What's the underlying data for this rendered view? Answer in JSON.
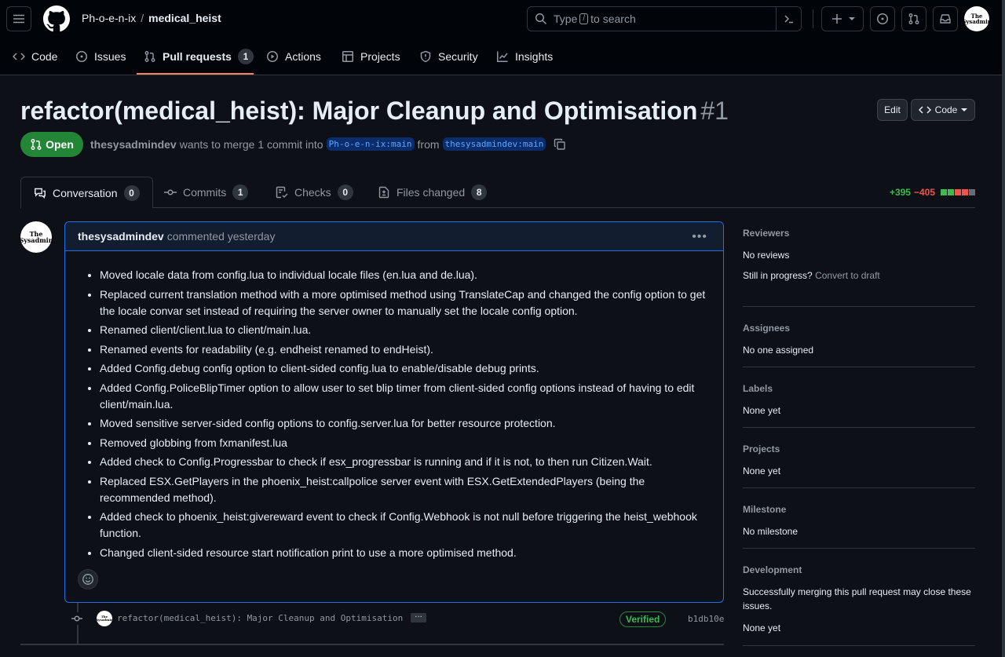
{
  "header": {
    "owner": "Ph-o-e-n-ix",
    "repo": "medical_heist",
    "search_prefix": "Type",
    "search_key": "/",
    "search_suffix": "to search",
    "avatar_text": "The Sysadmin"
  },
  "repo_tabs": [
    {
      "label": "Code",
      "icon": "code-icon"
    },
    {
      "label": "Issues",
      "icon": "issue-icon"
    },
    {
      "label": "Pull requests",
      "icon": "pull-request-icon",
      "count": "1"
    },
    {
      "label": "Actions",
      "icon": "play-icon"
    },
    {
      "label": "Projects",
      "icon": "table-icon"
    },
    {
      "label": "Security",
      "icon": "shield-icon"
    },
    {
      "label": "Insights",
      "icon": "graph-icon"
    }
  ],
  "pr": {
    "title": "refactor(medical_heist): Major Cleanup and Optimisation",
    "number": "#1",
    "edit_label": "Edit",
    "code_label": "Code",
    "state": "Open",
    "author": "thesysadmindev",
    "merge_text": "wants to merge 1 commit into",
    "base_branch": "Ph-o-e-n-ix:main",
    "from_text": "from",
    "head_branch": "thesysadmindev:main"
  },
  "pr_tabs": [
    {
      "label": "Conversation",
      "count": "0"
    },
    {
      "label": "Commits",
      "count": "1"
    },
    {
      "label": "Checks",
      "count": "0"
    },
    {
      "label": "Files changed",
      "count": "8"
    }
  ],
  "diffstat": {
    "additions": "+395",
    "deletions": "−405"
  },
  "comment": {
    "author": "thesysadmindev",
    "action": "commented yesterday",
    "items": [
      "Moved locale data from config.lua to individual locale files (en.lua and de.lua).",
      "Replaced current translation method with a more optimised method using TranslateCap and changed the config option to get the locale convar set instead of requiring the server owner to manually set the locale config option.",
      "Renamed client/client.lua to client/main.lua.",
      "Renamed events for readability (e.g. endheist renamed to endHeist).",
      "Added Config.debug config option to client-sided config.lua to enable/disable debug prints.",
      "Added Config.PoliceBlipTimer option to allow user to set blip timer from client-sided config options instead of having to edit client/main.lua.",
      "Moved sensitive server-sided config options to config.server.lua for better resource protection.",
      "Removed globbing from fxmanifest.lua",
      "Added check to Config.Progressbar to check if esx_progressbar is running and if it is not, to then run Citizen.Wait.",
      "Replaced ESX.GetPlayers in the phoenix_heist:callpolice server event with ESX.GetExtendedPlayers (being the recommended method).",
      "Added check to phoenix_heist:givereward event to check if Config.Webhook is not null before triggering the heist_webhook function.",
      "Changed client-sided resource start notification print to use a more optimised method."
    ]
  },
  "commit": {
    "message": "refactor(medical_heist): Major Cleanup and Optimisation",
    "ellipsis": "…",
    "verified": "Verified",
    "sha": "b1db10e"
  },
  "sidebar": {
    "reviewers": {
      "heading": "Reviewers",
      "value": "No reviews",
      "draft_question": "Still in progress?",
      "draft_link": "Convert to draft"
    },
    "assignees": {
      "heading": "Assignees",
      "value": "No one assigned"
    },
    "labels": {
      "heading": "Labels",
      "value": "None yet"
    },
    "projects": {
      "heading": "Projects",
      "value": "None yet"
    },
    "milestone": {
      "heading": "Milestone",
      "value": "No milestone"
    },
    "development": {
      "heading": "Development",
      "note": "Successfully merging this pull request may close these issues.",
      "value": "None yet"
    }
  }
}
